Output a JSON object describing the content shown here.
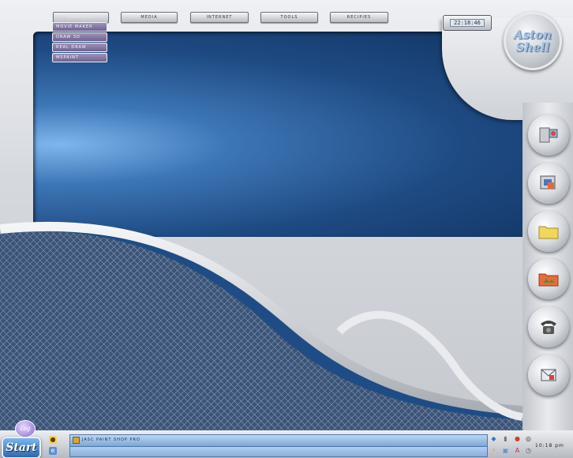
{
  "menu": {
    "items": [
      {
        "label": "Graphics",
        "active": true
      },
      {
        "label": "Media"
      },
      {
        "label": "Internet"
      },
      {
        "label": "Tools"
      },
      {
        "label": "Recipies"
      }
    ],
    "submenu": [
      "Movie Maker",
      "Draw 3D",
      "Real Draw",
      "MSPaint"
    ]
  },
  "clock": {
    "time": "22:18:46"
  },
  "logo": {
    "line1": "Aston",
    "line2": "Shell"
  },
  "side_buttons": [
    "computer-icon",
    "control-panel-icon",
    "folder-icon",
    "pictures-folder-icon",
    "telephone-icon",
    "mail-icon"
  ],
  "taskbar": {
    "start_label": "Start",
    "log_label": "Log",
    "task_label": "Jasc Paint Shop Pro",
    "time": "10:18 pm"
  },
  "colors": {
    "screen_blue": "#1e4a82",
    "submenu": "#7d72a0",
    "taskbar_accent": "#7aa6d8"
  }
}
